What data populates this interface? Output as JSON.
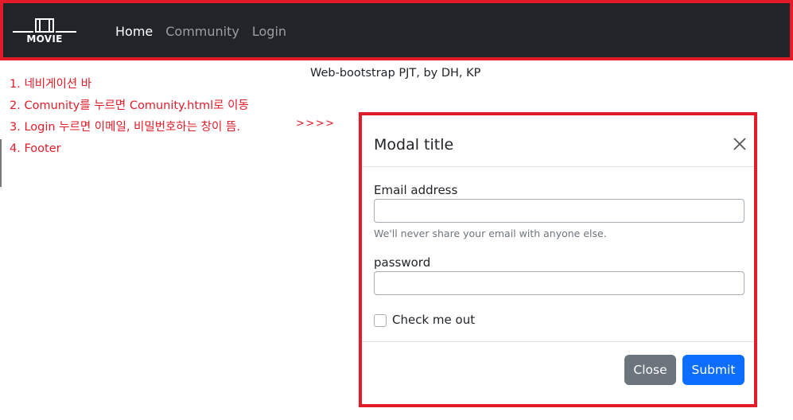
{
  "navbar": {
    "logo_text": "MOVIE",
    "links": [
      {
        "label": "Home"
      },
      {
        "label": "Community"
      },
      {
        "label": "Login"
      }
    ]
  },
  "subtitle": "Web-bootstrap PJT, by DH, KP",
  "notes": [
    "1. 네비게이션 바",
    "2. Comunity를 누르면 Comunity.html로 이동",
    "3. Login 누르면 이메일, 비밀번호하는 창이 뜸.",
    "4. Footer"
  ],
  "arrow_note": ">>>>",
  "modal": {
    "title": "Modal title",
    "email_label": "Email address",
    "email_value": "",
    "email_help": "We'll never share your email with anyone else.",
    "password_label": "password",
    "password_value": "",
    "checkbox_label": "Check me out",
    "checkbox_checked": false,
    "close_label": "Close",
    "submit_label": "Submit"
  },
  "colors": {
    "navbar_bg": "#212529",
    "annotation_red": "#e21c28",
    "primary": "#0d6efd",
    "secondary": "#6c757d"
  }
}
